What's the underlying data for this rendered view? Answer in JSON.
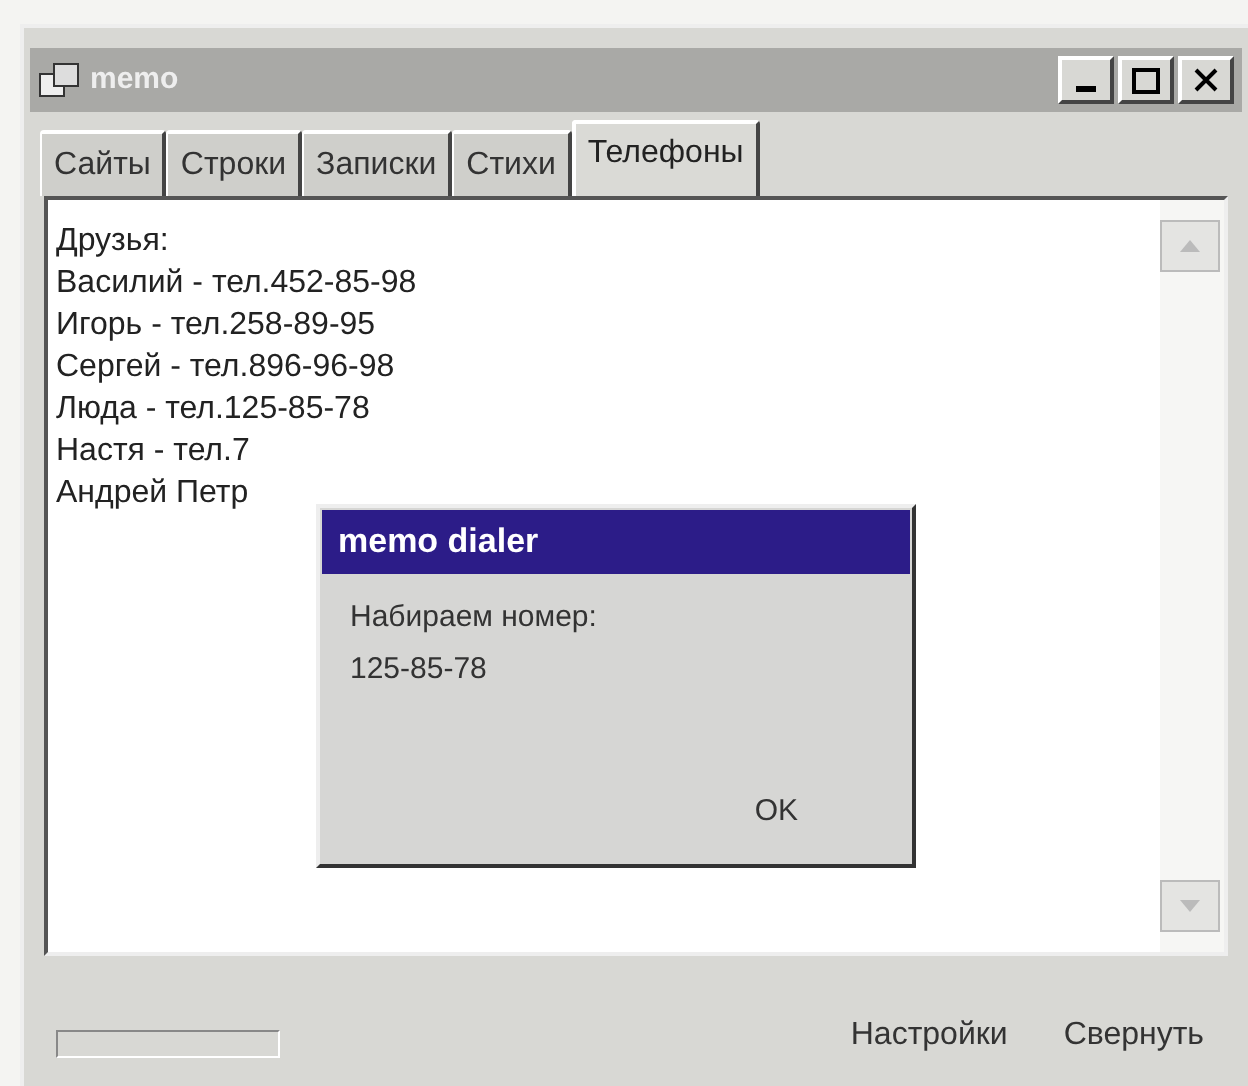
{
  "window": {
    "title": "memo"
  },
  "tabs": [
    {
      "label": "Сайты",
      "selected": false
    },
    {
      "label": "Строки",
      "selected": false
    },
    {
      "label": "Записки",
      "selected": false
    },
    {
      "label": "Стихи",
      "selected": false
    },
    {
      "label": "Телефоны",
      "selected": true
    }
  ],
  "lines": [
    "Друзья:",
    "Василий - тел.452-85-98",
    "Игорь - тел.258-89-95",
    "Сергей - тел.896-96-98",
    "Люда - тел.125-85-78",
    "Настя - тел.7",
    "Андрей Петр"
  ],
  "dialog": {
    "title": "memo dialer",
    "message": "Набираем номер:",
    "number": "125-85-78",
    "button": "OK"
  },
  "bottom_links": [
    "Настройки",
    "Свернуть"
  ]
}
